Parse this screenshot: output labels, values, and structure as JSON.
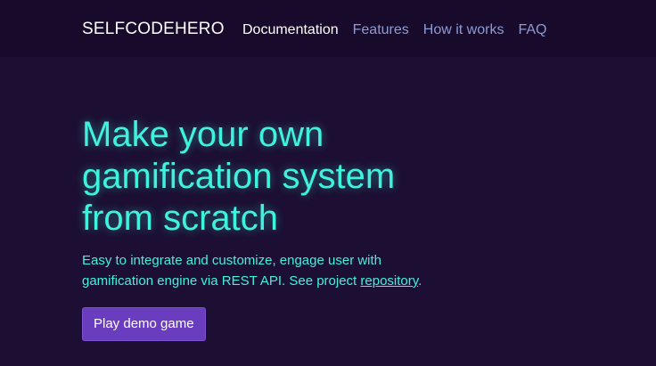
{
  "nav": {
    "brand": "SELFCODEHERO",
    "links": [
      {
        "label": "Documentation",
        "active": true
      },
      {
        "label": "Features",
        "active": false
      },
      {
        "label": "How it works",
        "active": false
      },
      {
        "label": "FAQ",
        "active": false
      }
    ]
  },
  "hero": {
    "title_lines": [
      "Make your own",
      "gamification system",
      "from scratch"
    ],
    "subtitle_part1": "Easy to integrate and customize, engage user with gamification engine via REST API. See project ",
    "subtitle_link": "repository",
    "subtitle_end": ".",
    "cta_label": "Play demo game"
  },
  "colors": {
    "background": "#1c0f33",
    "navbar": "#170a2b",
    "accent_text": "#3ff2dd",
    "nav_inactive": "#8f9bd4",
    "button": "#6a3dbf"
  }
}
